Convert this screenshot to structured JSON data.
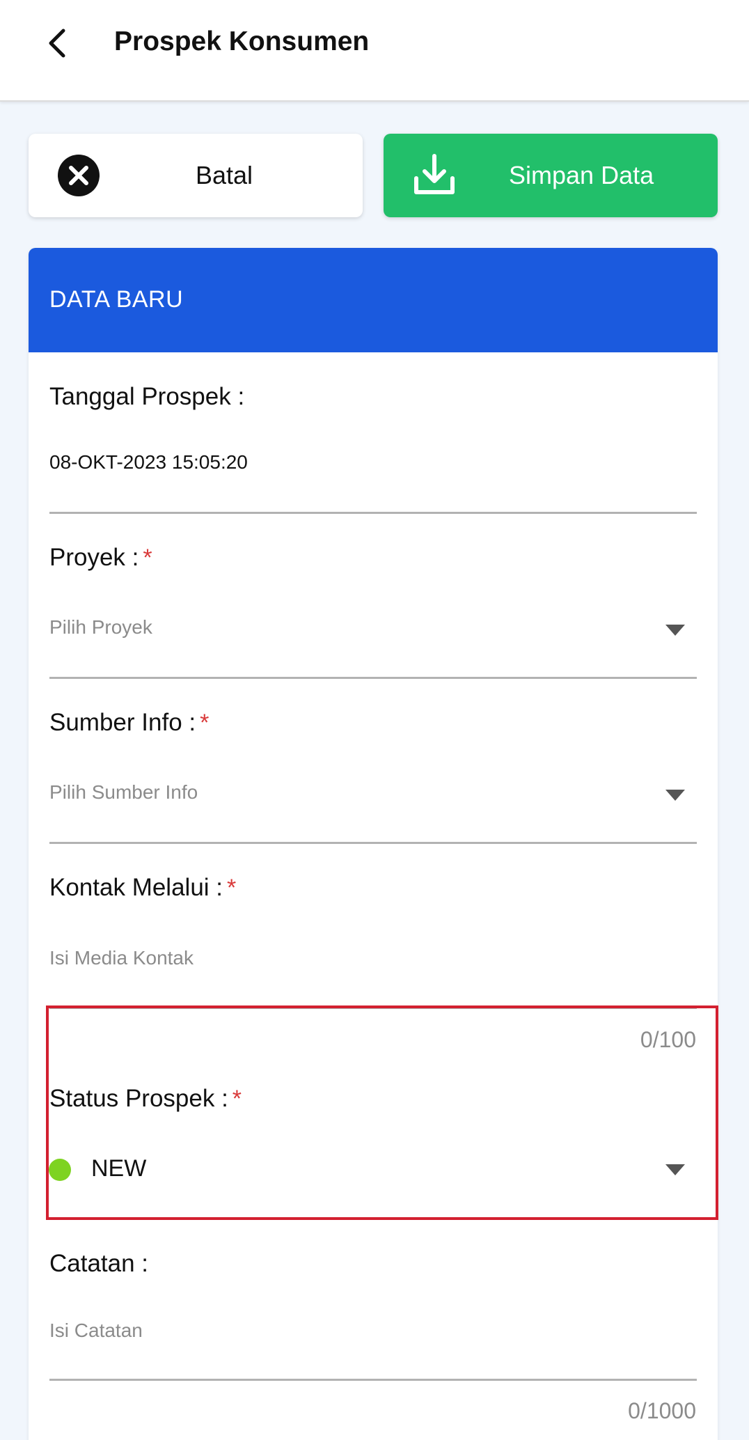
{
  "appbar": {
    "title": "Prospek Konsumen",
    "back_icon": "chevron-left-icon"
  },
  "actions": {
    "cancel_label": "Batal",
    "cancel_icon": "close-circle-icon",
    "save_label": "Simpan Data",
    "save_icon": "download-icon",
    "save_color": "#22bf6a"
  },
  "card": {
    "header_title": "DATA BARU",
    "header_color": "#1b5ade"
  },
  "form": {
    "tanggal": {
      "label": "Tanggal Prospek :",
      "value": "08-OKT-2023 15:05:20"
    },
    "proyek": {
      "label": "Proyek :",
      "required": "*",
      "placeholder": "Pilih Proyek"
    },
    "sumber_info": {
      "label": "Sumber Info :",
      "required": "*",
      "placeholder": "Pilih Sumber Info"
    },
    "kontak": {
      "label": "Kontak Melalui :",
      "required": "*",
      "placeholder": "Isi Media Kontak",
      "counter": "0/100"
    },
    "status": {
      "label": "Status Prospek :",
      "required": "*",
      "value": "NEW",
      "dot_color": "#7ed321"
    },
    "catatan": {
      "label": "Catatan :",
      "placeholder": "Isi Catatan",
      "counter": "0/1000"
    }
  },
  "colors": {
    "required": "#d93a3a",
    "highlight": "#d32030"
  }
}
